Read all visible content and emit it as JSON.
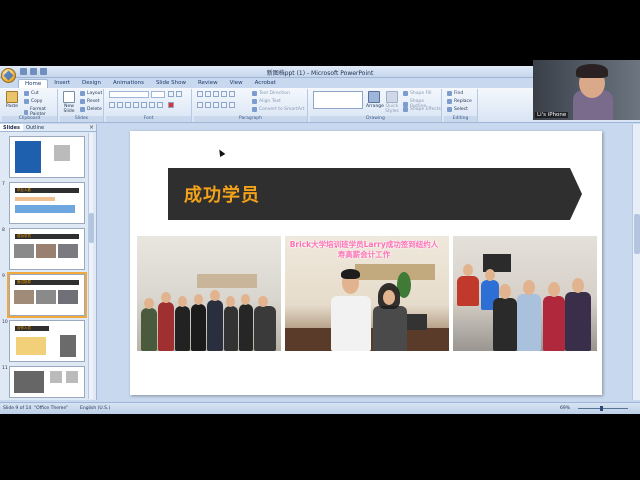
{
  "window": {
    "title": "新图档ppt (1) - Microsoft PowerPoint"
  },
  "tabs": [
    "Home",
    "Insert",
    "Design",
    "Animations",
    "Slide Show",
    "Review",
    "View",
    "Acrobat"
  ],
  "ribbon": {
    "clipboard": {
      "label": "Clipboard",
      "paste": "Paste",
      "cut": "Cut",
      "copy": "Copy",
      "format_painter": "Format Painter"
    },
    "slides": {
      "label": "Slides",
      "new_slide": "New Slide",
      "layout": "Layout",
      "reset": "Reset",
      "delete": "Delete"
    },
    "font": {
      "label": "Font"
    },
    "paragraph": {
      "label": "Paragraph",
      "text_direction": "Text Direction",
      "align_text": "Align Text",
      "convert_smartart": "Convert to SmartArt"
    },
    "drawing": {
      "label": "Drawing",
      "arrange": "Arrange",
      "quick_styles": "Quick Styles",
      "shape_fill": "Shape Fill",
      "shape_outline": "Shape Outline",
      "shape_effects": "Shape Effects"
    },
    "editing": {
      "label": "Editing",
      "find": "Find",
      "replace": "Replace",
      "select": "Select"
    }
  },
  "left_pane": {
    "tabs": [
      "Slides",
      "Outline"
    ],
    "close": "×",
    "slide_numbers": [
      "",
      "7",
      "8",
      "9",
      "10",
      "11"
    ],
    "thumb_titles": {
      "t2": "毕业人数",
      "t3": "成功学员",
      "t4": "面试指导",
      "t5": "合作人员"
    }
  },
  "slide": {
    "title": "成功学员",
    "caption": "Brick大学培训班学员Larry成功签到纽约人寿高薪会计工作"
  },
  "status_bar": {
    "slide_pos": "Slide 9 of 14",
    "theme": "\"Office Theme\"",
    "language": "English (U.S.)",
    "zoom": "69%"
  },
  "webcam": {
    "label": "Li's iPhone"
  },
  "colors": {
    "accent": "#f4a21a",
    "banner": "#2f2f2f",
    "ribbon_bg": "#dbe6f4"
  }
}
